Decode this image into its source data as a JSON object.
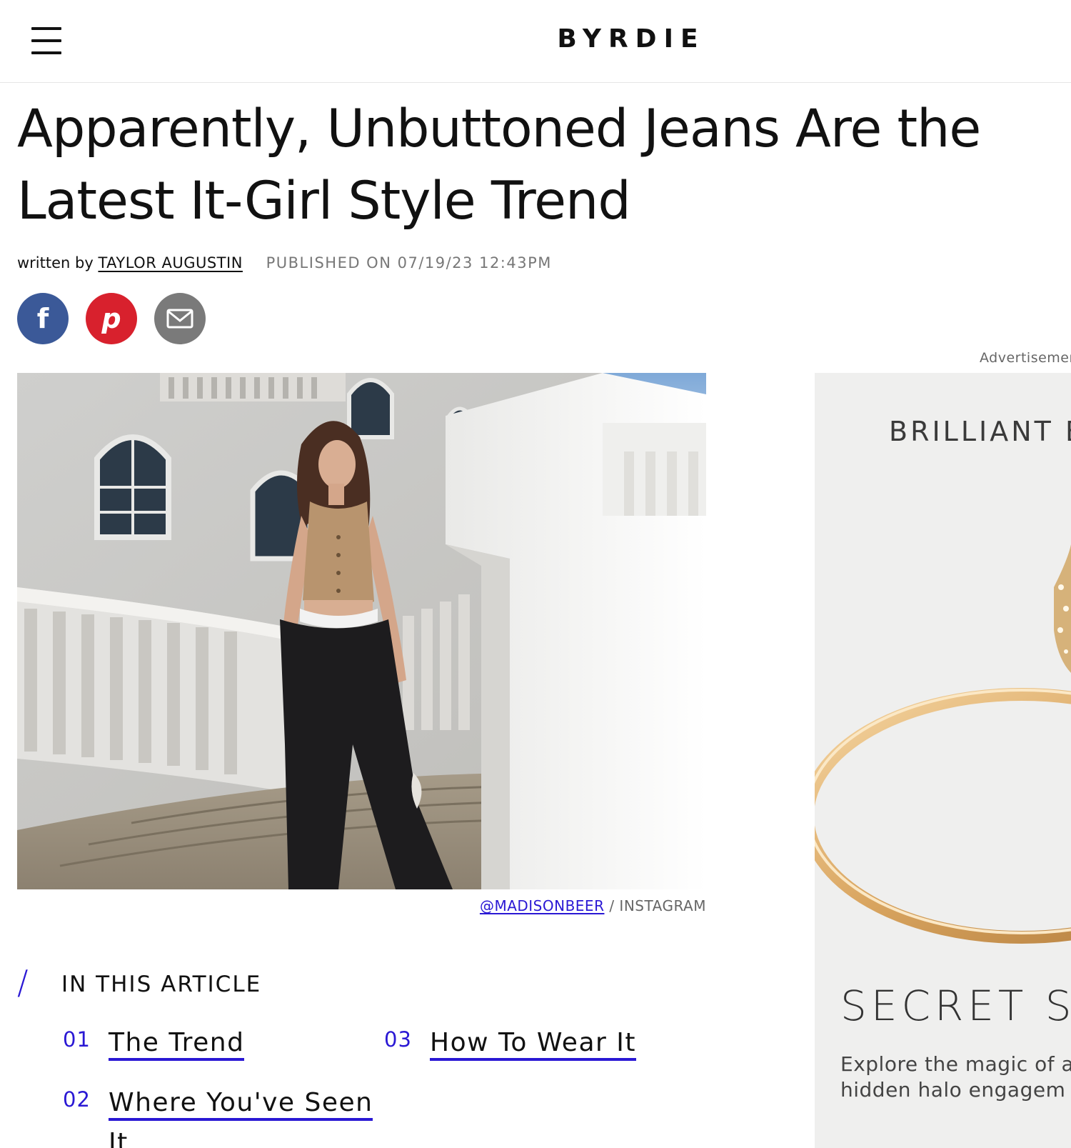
{
  "header": {
    "logo": "BYRDIE"
  },
  "article": {
    "title_line1": "Apparently, Unbuttoned Jeans Are the",
    "title_line2": "Latest It-Girl Style Trend",
    "byline_prefix": "written by",
    "author": "TAYLOR AUGUSTIN",
    "published": "PUBLISHED ON 07/19/23 12:43PM"
  },
  "social": {
    "facebook_glyph": "f",
    "pinterest_glyph": "p"
  },
  "hero": {
    "credit_handle": "@MADISONBEER",
    "credit_source": "/ INSTAGRAM"
  },
  "toc": {
    "heading": "IN THIS ARTICLE",
    "slash": "/",
    "items": [
      {
        "num": "01",
        "label": "The Trend"
      },
      {
        "num": "02",
        "label": "Where You've Seen It"
      },
      {
        "num": "03",
        "label": "How To Wear It"
      }
    ],
    "item2_line1": "Where You've Seen",
    "item2_line2": "It"
  },
  "ad": {
    "label": "Advertisement",
    "headline_top": "BRILLIANT E",
    "headline_bottom": "SECRET SI",
    "body_line1": "Explore the magic of a",
    "body_line2": "hidden halo engagem"
  },
  "colors": {
    "accent": "#2a18d4",
    "facebook": "#3b5998",
    "pinterest": "#d8212d",
    "email": "#7a7a7a"
  }
}
